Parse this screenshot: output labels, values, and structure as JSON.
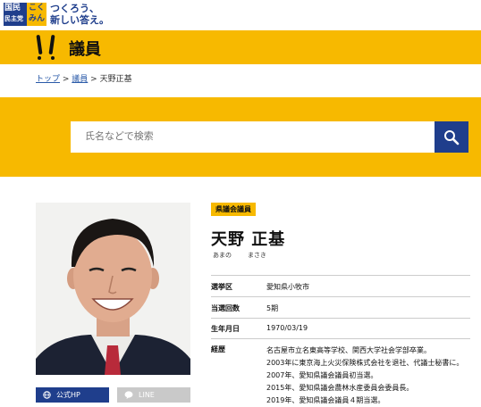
{
  "header": {
    "logo_line1": "国民",
    "logo_line1b": "民主党",
    "logo_line2": "こく",
    "logo_line2b": "みん",
    "tagline_line1": "つくろう、",
    "tagline_line2": "新しい答え。"
  },
  "page": {
    "title": "議員"
  },
  "breadcrumb": {
    "top": "トップ",
    "sep1": " > ",
    "members": "議員",
    "sep2": " > ",
    "current": "天野正基"
  },
  "search": {
    "placeholder": "氏名などで検索"
  },
  "links": {
    "hp": "公式HP",
    "line": "LINE"
  },
  "profile": {
    "category": "県議会議員",
    "name": "天野 正基",
    "kana_family": "あまの",
    "kana_given": "まさき",
    "rows": [
      {
        "key": "選挙区",
        "value": "愛知県小牧市"
      },
      {
        "key": "当選回数",
        "value": "5期"
      },
      {
        "key": "生年月日",
        "value": "1970/03/19"
      }
    ],
    "history_key": "経歴",
    "history": [
      "名古屋市立名東高等学校、関西大学社会学部卒業。",
      "2003年に東京海上火災保険株式会社を退社、代議士秘書に。",
      "2007年、愛知県議会議員初当選。",
      "2015年、愛知県議会農林水産委員会委員長。",
      "2019年、愛知県議会議員４期当選。"
    ]
  },
  "colors": {
    "brand_yellow": "#f7b900",
    "brand_navy": "#1f3e8c"
  }
}
